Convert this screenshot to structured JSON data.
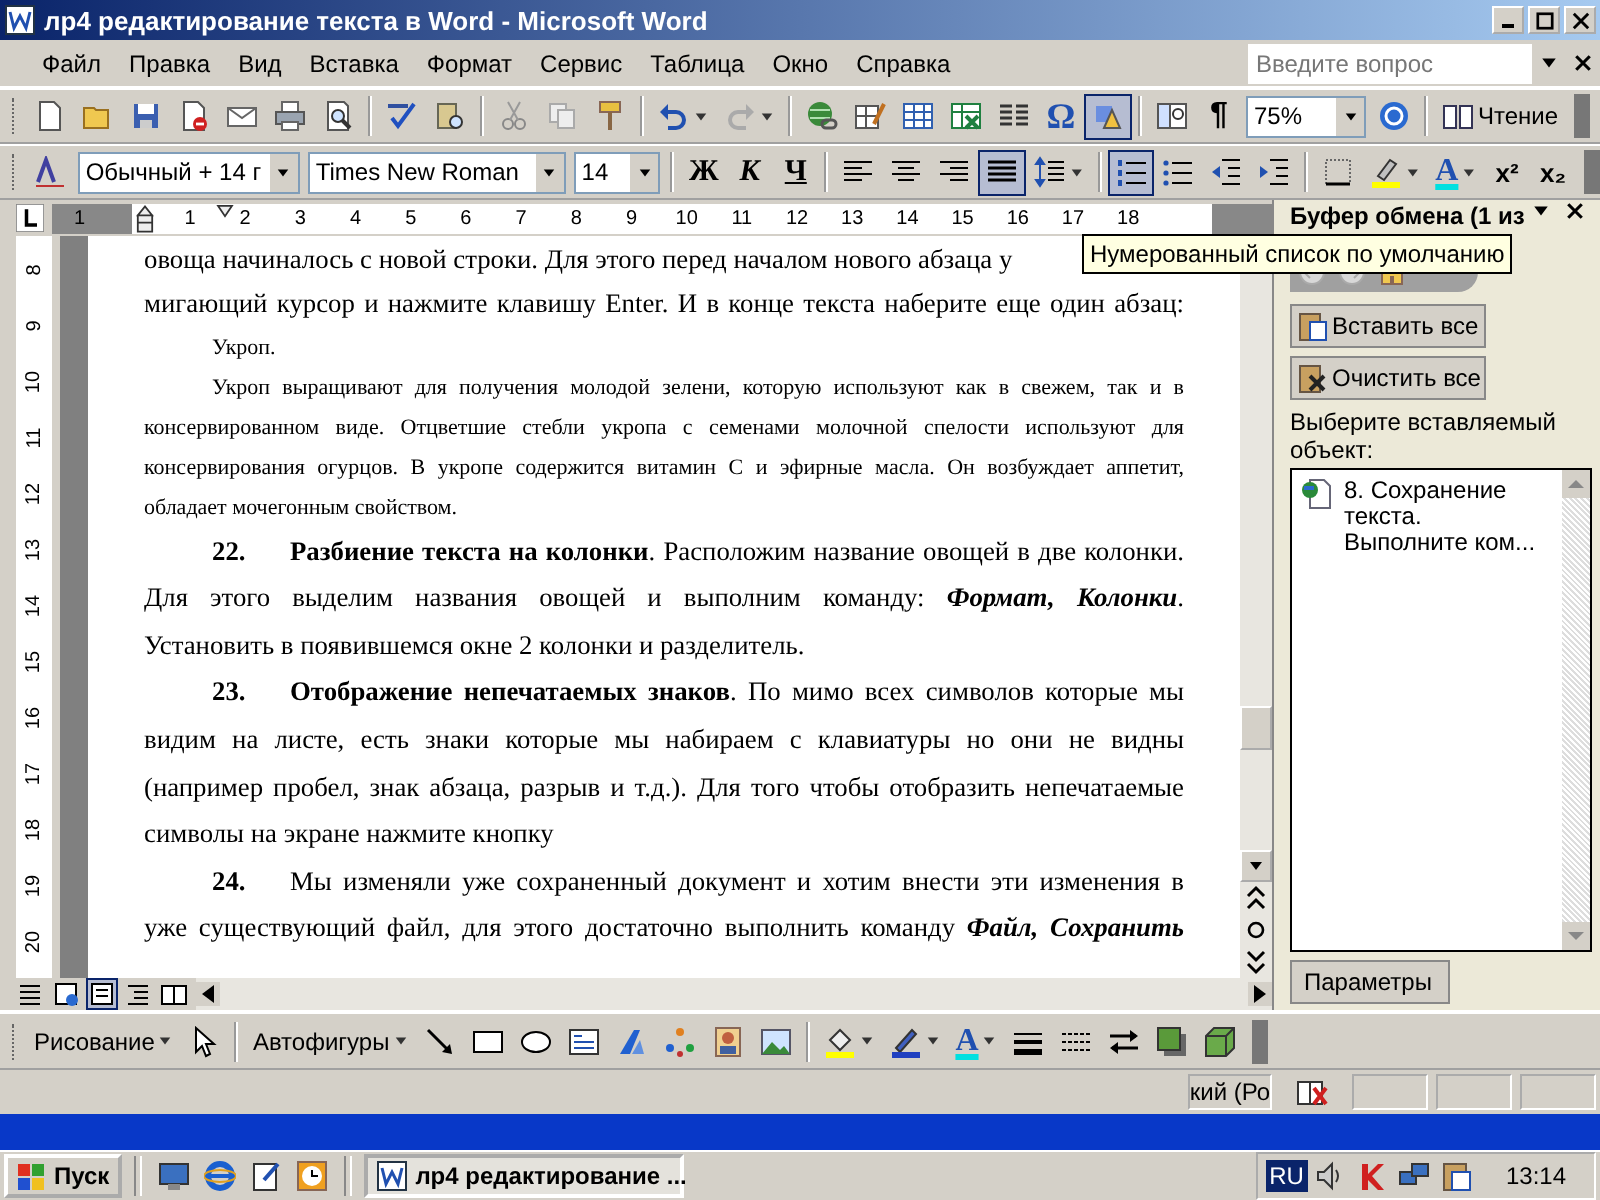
{
  "window": {
    "title": "лр4 редактирование текста в Word - Microsoft Word"
  },
  "menu": [
    "Файл",
    "Правка",
    "Вид",
    "Вставка",
    "Формат",
    "Сервис",
    "Таблица",
    "Окно",
    "Справка"
  ],
  "help_search": {
    "placeholder": "Введите вопрос"
  },
  "standard_toolbar": [
    [
      {
        "kind": "new",
        "pressed": false
      },
      {
        "kind": "open",
        "pressed": false
      },
      {
        "kind": "save",
        "pressed": false
      },
      {
        "kind": "permission",
        "pressed": false
      },
      {
        "kind": "email",
        "pressed": false
      },
      {
        "kind": "print",
        "pressed": false
      },
      {
        "kind": "preview",
        "pressed": false
      }
    ],
    [
      {
        "kind": "spelling",
        "pressed": false
      },
      {
        "kind": "research",
        "pressed": false
      }
    ],
    [
      {
        "kind": "cut",
        "pressed": false
      },
      {
        "kind": "copy",
        "pressed": false
      },
      {
        "kind": "painter",
        "pressed": false
      }
    ],
    [
      {
        "kind": "undo",
        "pressed": false
      },
      {
        "kind": "redo",
        "pressed": false
      }
    ],
    [
      {
        "kind": "hyperlink",
        "pressed": false
      },
      {
        "kind": "tables",
        "pressed": false
      },
      {
        "kind": "table",
        "pressed": false
      },
      {
        "kind": "excel",
        "pressed": false
      },
      {
        "kind": "columns",
        "pressed": false
      },
      {
        "kind": "symbol",
        "label": "Ω",
        "pressed": false
      },
      {
        "kind": "drawing",
        "pressed": true
      }
    ],
    [
      {
        "kind": "docmap",
        "pressed": false
      },
      {
        "kind": "pilcrow",
        "label": "¶",
        "pressed": false
      },
      {
        "kind": "zoom",
        "value": "75%"
      },
      {
        "kind": "help",
        "pressed": false
      }
    ],
    [
      {
        "kind": "reading",
        "label": "Чтение",
        "pressed": false
      }
    ]
  ],
  "formatting_toolbar": [
    [
      {
        "kind": "styles",
        "pressed": false
      },
      {
        "kind": "style",
        "value": "Обычный + 14 г"
      },
      {
        "kind": "font",
        "value": "Times New Roman"
      },
      {
        "kind": "size",
        "value": "14"
      }
    ],
    [
      {
        "kind": "bold",
        "label": "Ж",
        "pressed": false
      },
      {
        "kind": "italic",
        "label": "К",
        "pressed": false
      },
      {
        "kind": "underline",
        "label": "Ч",
        "pressed": false
      }
    ],
    [
      {
        "kind": "align-left",
        "pressed": false
      },
      {
        "kind": "align-center",
        "pressed": false
      },
      {
        "kind": "align-right",
        "pressed": false
      },
      {
        "kind": "justify",
        "pressed": true
      },
      {
        "kind": "spacing",
        "pressed": false
      }
    ],
    [
      {
        "kind": "numbering",
        "pressed": true
      },
      {
        "kind": "bullets",
        "pressed": false
      },
      {
        "kind": "outdent",
        "pressed": false
      },
      {
        "kind": "indent",
        "pressed": false
      }
    ],
    [
      {
        "kind": "border",
        "pressed": false
      },
      {
        "kind": "highlight",
        "pressed": false
      },
      {
        "kind": "fontcolor",
        "label": "A",
        "pressed": false
      },
      {
        "kind": "superscript",
        "label": "x²",
        "pressed": false
      },
      {
        "kind": "subscript",
        "label": "x₂",
        "pressed": false
      }
    ]
  ],
  "ruler": {
    "marks": [
      "1",
      "1",
      "2",
      "3",
      "4",
      "5",
      "6",
      "7",
      "8",
      "9",
      "10",
      "11",
      "12",
      "13",
      "14",
      "15",
      "16",
      "17",
      "18"
    ]
  },
  "vertical_ruler": {
    "marks": [
      "8",
      "9",
      "10",
      "11",
      "12",
      "13",
      "14",
      "15",
      "16",
      "17",
      "18",
      "19",
      "20"
    ]
  },
  "document": {
    "lines": [
      {
        "kind": "body",
        "text": "овоща начиналось с новой строки. Для этого перед началом нового абзаца у",
        "justified": false,
        "indent": false
      },
      {
        "kind": "body",
        "text": "мигающий курсор и нажмите клавишу Enter. И в конце текста наберите еще один абзац:",
        "justified": true,
        "indent": false
      },
      {
        "kind": "small",
        "text": "Укроп.",
        "justified": false,
        "indent": true
      },
      {
        "kind": "small",
        "text": "Укроп выращивают для получения молодой зелени, которую используют как в свежем, так и в",
        "justified": true,
        "indent": true
      },
      {
        "kind": "small",
        "text": "консервированном виде. Отцветшие стебли укропа с семенами молочной спелости используют для",
        "justified": true,
        "indent": false
      },
      {
        "kind": "small",
        "text": "консервирования огурцов. В укропе содержится витамин С и эфирные масла. Он возбуждает аппетит,",
        "justified": true,
        "indent": false
      },
      {
        "kind": "small",
        "text": "обладает мочегонным свойством.",
        "justified": false,
        "indent": false
      },
      {
        "kind": "numbered",
        "number": "22.",
        "text": "**Разбиение текста на колонки**. Расположим название овощей в две колонки.",
        "justified": true,
        "indent": true
      },
      {
        "kind": "body",
        "text": "Для этого выделим названия овощей и выполним команду: **Формат, Колонки**.",
        "justified": true,
        "indent": false,
        "bold_italic": true
      },
      {
        "kind": "body",
        "text": "Установить в появившемся окне 2 колонки и разделитель.",
        "justified": false,
        "indent": false
      },
      {
        "kind": "numbered",
        "number": "23.",
        "text": "**Отображение непечатаемых знаков**. По мимо всех символов которые мы",
        "justified": true,
        "indent": true
      },
      {
        "kind": "body",
        "text": "видим на листе, есть знаки которые мы набираем с клавиатуры но они не видны",
        "justified": true,
        "indent": false
      },
      {
        "kind": "body",
        "text": "(например пробел, знак абзаца, разрыв и т.д.). Для того чтобы отобразить непечатаемые",
        "justified": true,
        "indent": false
      },
      {
        "kind": "body",
        "text": "символы на экране нажмите кнопку",
        "justified": false,
        "indent": false
      },
      {
        "kind": "numbered",
        "number": "24.",
        "text": "Мы изменяли уже сохраненный документ и хотим внести эти изменения в",
        "justified": true,
        "indent": true
      },
      {
        "kind": "body",
        "text": "уже существующий файл, для этого достаточно выполнить команду **Файл, Сохранить**",
        "justified": true,
        "indent": false,
        "bold_italic": true
      }
    ]
  },
  "tooltip": "Нумерованный список по умолчанию",
  "task_pane": {
    "title": "Буфер обмена (1 из",
    "paste_all": "Вставить все",
    "clear_all": "Очистить все",
    "prompt": "Выберите вставляемый объект:",
    "items": [
      "8. Сохранение текста. Выполните ком..."
    ],
    "options": "Параметры"
  },
  "drawing_toolbar": [
    [
      {
        "kind": "draw-menu",
        "label": "Рисование",
        "pressed": false
      },
      {
        "kind": "pointer",
        "pressed": false
      }
    ],
    [
      {
        "kind": "autoshapes",
        "label": "Автофигуры",
        "pressed": false
      },
      {
        "kind": "arrow",
        "pressed": false
      },
      {
        "kind": "rect",
        "pressed": false
      },
      {
        "kind": "oval",
        "pressed": false
      },
      {
        "kind": "textbox",
        "pressed": false
      },
      {
        "kind": "wordart",
        "pressed": false
      },
      {
        "kind": "diagram",
        "pressed": false
      },
      {
        "kind": "clipart",
        "pressed": false
      },
      {
        "kind": "picture",
        "pressed": false
      }
    ],
    [
      {
        "kind": "fill",
        "pressed": false
      },
      {
        "kind": "linecolor",
        "pressed": false
      },
      {
        "kind": "fontcolor",
        "label": "A",
        "pressed": false
      },
      {
        "kind": "linestyle",
        "pressed": false
      },
      {
        "kind": "dashstyle",
        "pressed": false
      },
      {
        "kind": "arrowstyle",
        "pressed": false
      },
      {
        "kind": "shadow",
        "pressed": false
      },
      {
        "kind": "cube",
        "pressed": false
      }
    ]
  ],
  "status_bar": {
    "language": "кий (Ро"
  },
  "taskbar": {
    "start": "Пуск",
    "tasks": [
      {
        "label": "лр4 редактирование ...",
        "selected": true
      }
    ],
    "language": "RU",
    "clock": "13:14"
  }
}
